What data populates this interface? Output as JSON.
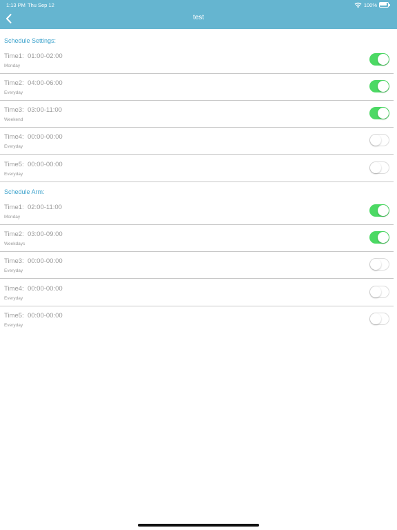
{
  "status_bar": {
    "time": "1:13 PM",
    "date": "Thu Sep 12",
    "battery": "100%"
  },
  "nav": {
    "title": "test",
    "back_icon": "chevron-left-icon"
  },
  "colors": {
    "nav_bar": "#65b5d0",
    "section_header": "#3ea3cc",
    "toggle_on": "#4cd964"
  },
  "schedule_settings": {
    "header": "Schedule Settings:",
    "items": [
      {
        "time": "Time1:  01:00-02:00",
        "repeat": "Monday",
        "enabled": true
      },
      {
        "time": "Time2:  04:00-06:00",
        "repeat": "Everyday",
        "enabled": true
      },
      {
        "time": "Time3:  03:00-11:00",
        "repeat": "Weekend",
        "enabled": true
      },
      {
        "time": "Time4:  00:00-00:00",
        "repeat": "Everyday",
        "enabled": false
      },
      {
        "time": "Time5:  00:00-00:00",
        "repeat": "Everyday",
        "enabled": false
      }
    ]
  },
  "schedule_arm": {
    "header": "Schedule Arm:",
    "items": [
      {
        "time": "Time1:  02:00-11:00",
        "repeat": "Monday",
        "enabled": true
      },
      {
        "time": "Time2:  03:00-09:00",
        "repeat": "Weekdays",
        "enabled": true
      },
      {
        "time": "Time3:  00:00-00:00",
        "repeat": "Everyday",
        "enabled": false
      },
      {
        "time": "Time4:  00:00-00:00",
        "repeat": "Everyday",
        "enabled": false
      },
      {
        "time": "Time5:  00:00-00:00",
        "repeat": "Everyday",
        "enabled": false
      }
    ]
  }
}
